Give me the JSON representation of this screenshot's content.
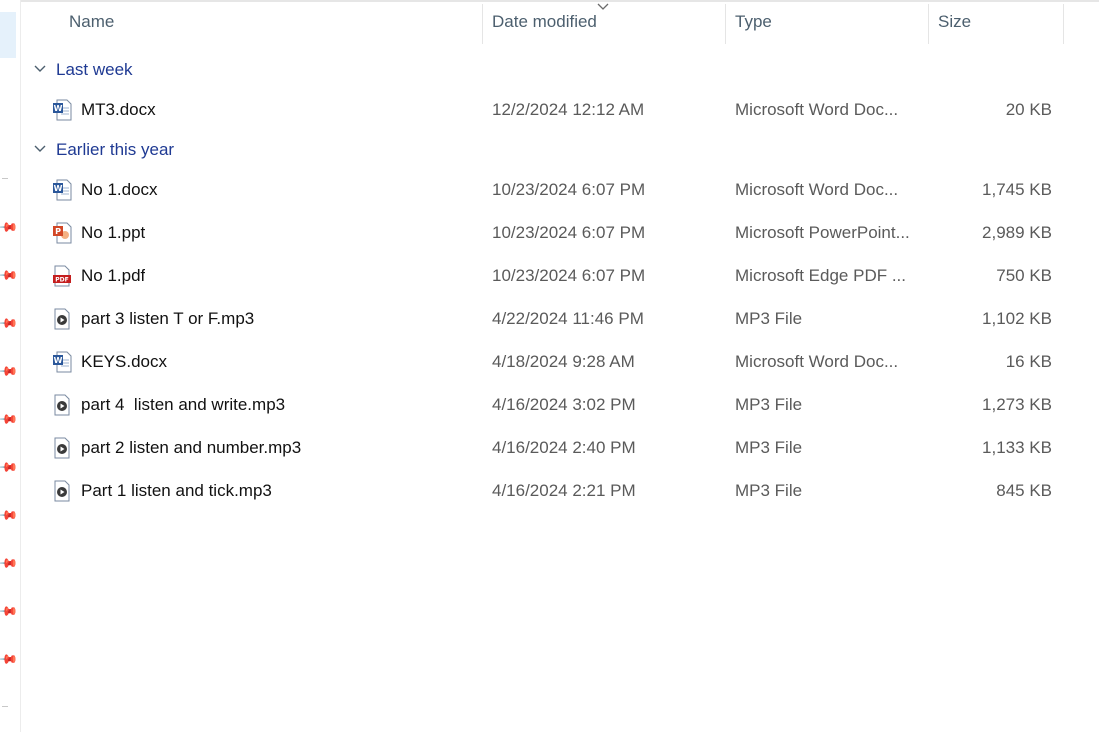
{
  "columns": {
    "name": "Name",
    "date": "Date modified",
    "type": "Type",
    "size": "Size"
  },
  "groups": [
    {
      "label": "Last week",
      "files": [
        {
          "name": "MT3.docx",
          "date": "12/2/2024 12:12 AM",
          "type": "Microsoft Word Doc...",
          "size": "20 KB",
          "icon": "word-icon"
        }
      ]
    },
    {
      "label": "Earlier this year",
      "files": [
        {
          "name": "No 1.docx",
          "date": "10/23/2024 6:07 PM",
          "type": "Microsoft Word Doc...",
          "size": "1,745 KB",
          "icon": "word-icon"
        },
        {
          "name": "No 1.ppt",
          "date": "10/23/2024 6:07 PM",
          "type": "Microsoft PowerPoint...",
          "size": "2,989 KB",
          "icon": "powerpoint-icon"
        },
        {
          "name": "No 1.pdf",
          "date": "10/23/2024 6:07 PM",
          "type": "Microsoft Edge PDF ...",
          "size": "750 KB",
          "icon": "pdf-icon"
        },
        {
          "name": "part 3 listen T or F.mp3",
          "date": "4/22/2024 11:46 PM",
          "type": "MP3 File",
          "size": "1,102 KB",
          "icon": "audio-icon"
        },
        {
          "name": "KEYS.docx",
          "date": "4/18/2024 9:28 AM",
          "type": "Microsoft Word Doc...",
          "size": "16 KB",
          "icon": "word-icon"
        },
        {
          "name": "part 4  listen and write.mp3",
          "date": "4/16/2024 3:02 PM",
          "type": "MP3 File",
          "size": "1,273 KB",
          "icon": "audio-icon"
        },
        {
          "name": "part 2 listen and number.mp3",
          "date": "4/16/2024 2:40 PM",
          "type": "MP3 File",
          "size": "1,133 KB",
          "icon": "audio-icon"
        },
        {
          "name": "Part 1 listen and tick.mp3",
          "date": "4/16/2024 2:21 PM",
          "type": "MP3 File",
          "size": "845 KB",
          "icon": "audio-icon"
        }
      ]
    }
  ],
  "colors": {
    "group_text": "#1f3a93",
    "header_text": "#4c5f6e",
    "selection": "#e5f1fb",
    "word": "#2b579a",
    "powerpoint": "#d24726",
    "pdf": "#c41e1e"
  }
}
